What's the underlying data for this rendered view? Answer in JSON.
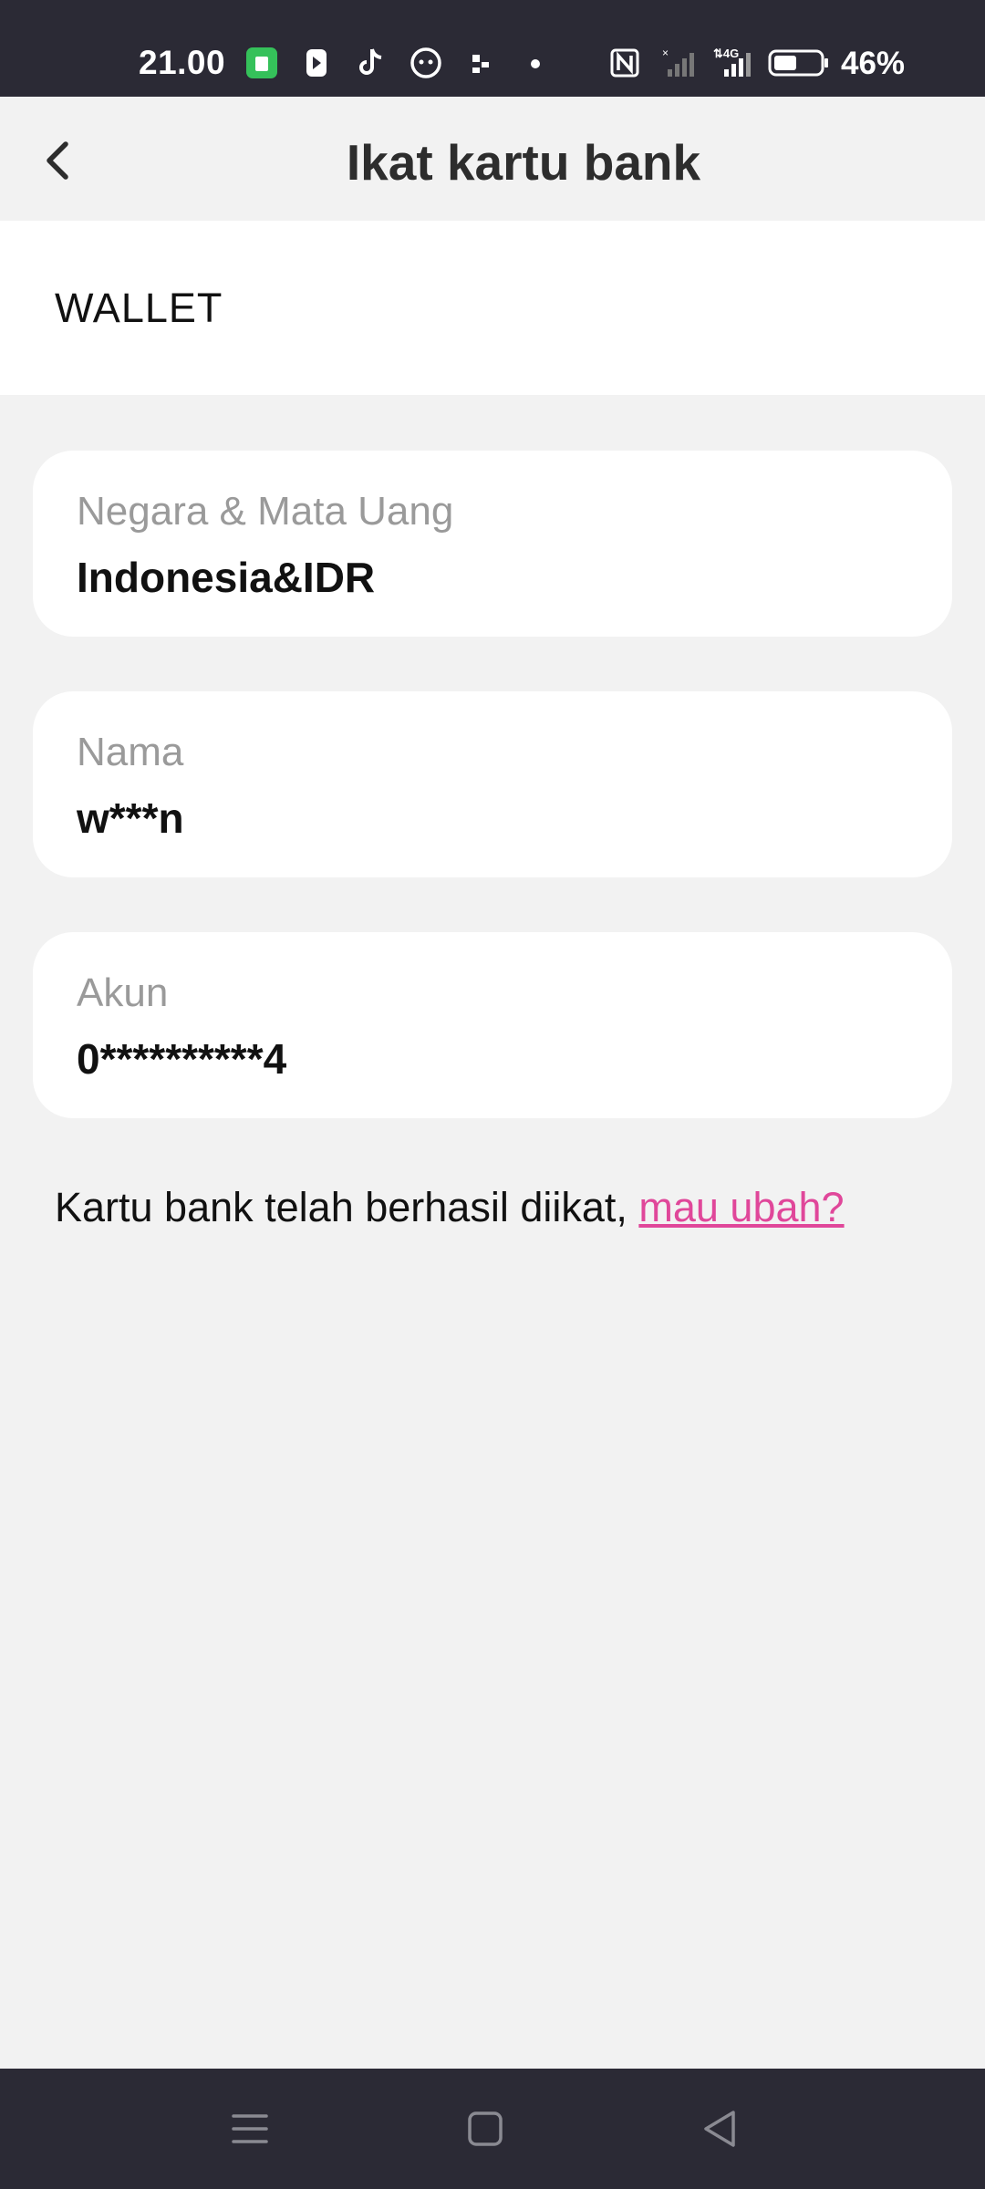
{
  "status_bar": {
    "time": "21.00",
    "battery_percent": "46%",
    "left_icons": [
      "shop-app-icon",
      "video-app-icon",
      "tiktok-icon",
      "chat-bot-icon",
      "qr-icon",
      "dot-icon"
    ],
    "right_icons": [
      "nfc-icon",
      "no-signal-icon",
      "4g-signal-icon",
      "battery-icon"
    ]
  },
  "header": {
    "title": "Ikat kartu bank",
    "back_icon": "chevron-left-icon"
  },
  "wallet": {
    "label": "WALLET"
  },
  "cards": {
    "country": {
      "label": "Negara & Mata Uang",
      "value": "Indonesia&IDR"
    },
    "name": {
      "label": "Nama",
      "value": "w***n"
    },
    "account": {
      "label": "Akun",
      "value": "0**********4"
    }
  },
  "note": {
    "text": "Kartu bank telah berhasil diikat, ",
    "link": "mau ubah?"
  },
  "colors": {
    "accent": "#e0479a",
    "system_bar": "#2b2a35",
    "background": "#f2f2f2"
  },
  "nav_bar": {
    "icons": [
      "menu-icon",
      "home-icon",
      "back-icon"
    ]
  }
}
